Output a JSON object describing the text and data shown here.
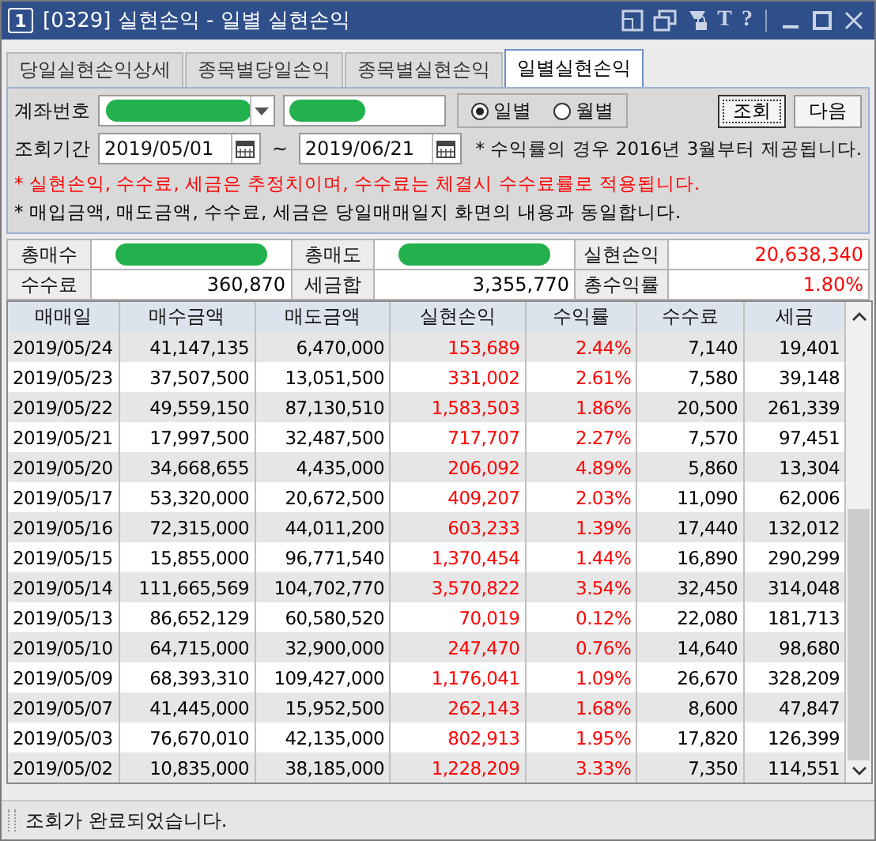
{
  "window": {
    "badge": "1",
    "title": "[0329] 실현손익 - 일별 실현손익",
    "glyphs": [
      "T",
      "?"
    ]
  },
  "tabs": [
    {
      "label": "당일실현손익상세",
      "selected": false
    },
    {
      "label": "종목별당일손익",
      "selected": false
    },
    {
      "label": "종목별실현손익",
      "selected": false
    },
    {
      "label": "일별실현손익",
      "selected": true
    }
  ],
  "query": {
    "account_label": "계좌번호",
    "radios": [
      {
        "label": "일별",
        "selected": true
      },
      {
        "label": "월별",
        "selected": false
      }
    ],
    "buttons": [
      "조회",
      "다음"
    ],
    "period_label": "조회기간",
    "date_from": "2019/05/01",
    "tilde": "~",
    "date_to": "2019/06/21",
    "note": "* 수익률의 경우 2016년 3월부터 제공됩니다.",
    "notices": [
      {
        "text": "* 실현손익, 수수료, 세금은 추정치이며, 수수료는 체결시 수수료률로 적용됩니다.",
        "color": "#ff0000"
      },
      {
        "text": "* 매입금액, 매도금액, 수수료, 세금은 당일매매일지 화면의 내용과 동일합니다.",
        "color": "#000000"
      }
    ]
  },
  "summary": [
    [
      {
        "label": "총매수"
      },
      {
        "label": "총매도"
      },
      {
        "label": "실현손익",
        "value": "20,638,340",
        "color": "#ff0000"
      }
    ],
    [
      {
        "label": "수수료",
        "value": "360,870",
        "color": "#000000"
      },
      {
        "label": "세금합",
        "value": "3,355,770",
        "color": "#000000"
      },
      {
        "label": "총수익률",
        "value": "1.80%",
        "color": "#ff0000"
      }
    ]
  ],
  "table": {
    "columns": [
      {
        "label": "매매일",
        "color": "#000000"
      },
      {
        "label": "매수금액",
        "color": "#000000"
      },
      {
        "label": "매도금액",
        "color": "#000000"
      },
      {
        "label": "실현손익",
        "color": "#ff0000"
      },
      {
        "label": "수익률",
        "color": "#ff0000"
      },
      {
        "label": "수수료",
        "color": "#000000"
      },
      {
        "label": "세금",
        "color": "#000000"
      }
    ],
    "rows": [
      [
        "2019/05/24",
        "41,147,135",
        "6,470,000",
        "153,689",
        "2.44%",
        "7,140",
        "19,401"
      ],
      [
        "2019/05/23",
        "37,507,500",
        "13,051,500",
        "331,002",
        "2.61%",
        "7,580",
        "39,148"
      ],
      [
        "2019/05/22",
        "49,559,150",
        "87,130,510",
        "1,583,503",
        "1.86%",
        "20,500",
        "261,339"
      ],
      [
        "2019/05/21",
        "17,997,500",
        "32,487,500",
        "717,707",
        "2.27%",
        "7,570",
        "97,451"
      ],
      [
        "2019/05/20",
        "34,668,655",
        "4,435,000",
        "206,092",
        "4.89%",
        "5,860",
        "13,304"
      ],
      [
        "2019/05/17",
        "53,320,000",
        "20,672,500",
        "409,207",
        "2.03%",
        "11,090",
        "62,006"
      ],
      [
        "2019/05/16",
        "72,315,000",
        "44,011,200",
        "603,233",
        "1.39%",
        "17,440",
        "132,012"
      ],
      [
        "2019/05/15",
        "15,855,000",
        "96,771,540",
        "1,370,454",
        "1.44%",
        "16,890",
        "290,299"
      ],
      [
        "2019/05/14",
        "111,665,569",
        "104,702,770",
        "3,570,822",
        "3.54%",
        "32,450",
        "314,048"
      ],
      [
        "2019/05/13",
        "86,652,129",
        "60,580,520",
        "70,019",
        "0.12%",
        "22,080",
        "181,713"
      ],
      [
        "2019/05/10",
        "64,715,000",
        "32,900,000",
        "247,470",
        "0.76%",
        "14,640",
        "98,680"
      ],
      [
        "2019/05/09",
        "68,393,310",
        "109,427,000",
        "1,176,041",
        "1.09%",
        "26,670",
        "328,209"
      ],
      [
        "2019/05/07",
        "41,445,000",
        "15,952,500",
        "262,143",
        "1.68%",
        "8,600",
        "47,847"
      ],
      [
        "2019/05/03",
        "76,670,010",
        "42,135,000",
        "802,913",
        "1.95%",
        "17,820",
        "126,399"
      ],
      [
        "2019/05/02",
        "10,835,000",
        "38,185,000",
        "1,228,209",
        "3.33%",
        "7,350",
        "114,551"
      ]
    ]
  },
  "status_bar": "조회가 완료되었습니다."
}
